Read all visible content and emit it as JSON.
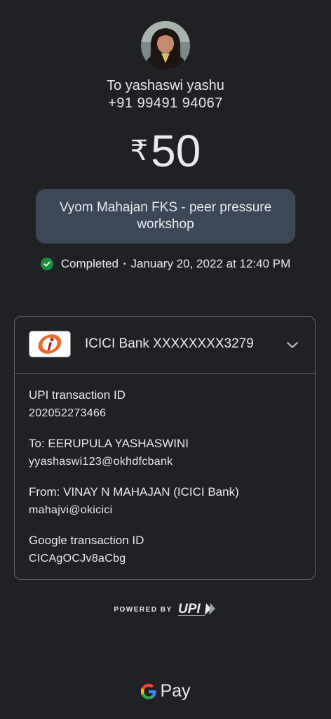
{
  "recipient": {
    "name_line": "To yashaswi yashu",
    "phone": "+91 99491 94067"
  },
  "amount": {
    "currency_symbol": "₹",
    "value": "50"
  },
  "note": "Vyom Mahajan FKS - peer pressure workshop",
  "status": {
    "label": "Completed",
    "separator": "•",
    "datetime": "January 20, 2022 at 12:40 PM"
  },
  "account": {
    "bank_label": "ICICI Bank XXXXXXXX3279"
  },
  "details": {
    "upi_txn_label": "UPI transaction ID",
    "upi_txn_value": "202052273466",
    "to_label": "To: EERUPULA YASHASWINI",
    "to_value": "yyashaswi123@okhdfcbank",
    "from_label": "From: VINAY N MAHAJAN (ICICI Bank)",
    "from_value": "mahajvi@okicici",
    "google_txn_label": "Google transaction ID",
    "google_txn_value": "CICAgOCJv8aCbg"
  },
  "footer": {
    "powered_by": "POWERED BY",
    "brand": "Pay"
  },
  "colors": {
    "background": "#202124",
    "note_bg": "#3c4758",
    "success": "#1e8e3e",
    "border": "#5f6368"
  }
}
